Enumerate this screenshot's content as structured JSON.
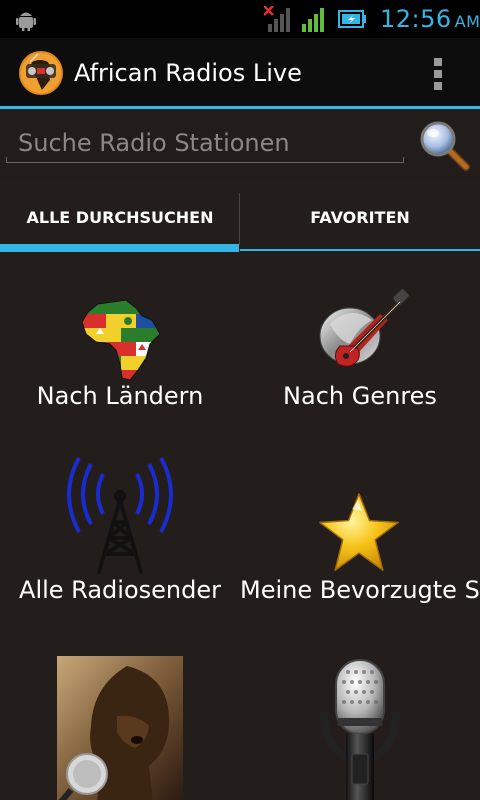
{
  "status_bar": {
    "time": "12:56",
    "ampm": "AM",
    "icons": [
      "android-debug-icon",
      "no-signal-icon",
      "signal-icon",
      "battery-charging-icon"
    ],
    "accent_color": "#33b5e5"
  },
  "action_bar": {
    "title": "African Radios Live",
    "app_icon": "african-radio-app-icon",
    "overflow_icon": "overflow-menu-icon"
  },
  "search": {
    "placeholder": "Suche Radio Stationen",
    "value": "",
    "button_icon": "magnifier-icon"
  },
  "tabs": [
    {
      "label": "ALLE DURCHSUCHEN",
      "selected": true
    },
    {
      "label": "FAVORITEN",
      "selected": false
    }
  ],
  "grid": [
    {
      "label": "Nach Ländern",
      "icon": "africa-flags-map-icon"
    },
    {
      "label": "Nach Genres",
      "icon": "guitar-genres-icon"
    },
    {
      "label": "Alle Radiosender",
      "icon": "radio-tower-icon"
    },
    {
      "label": "Meine Bevorzugte Station",
      "icon": "star-icon"
    },
    {
      "label": "",
      "icon": "singer-photo-icon"
    },
    {
      "label": "",
      "icon": "microphone-icon"
    }
  ]
}
